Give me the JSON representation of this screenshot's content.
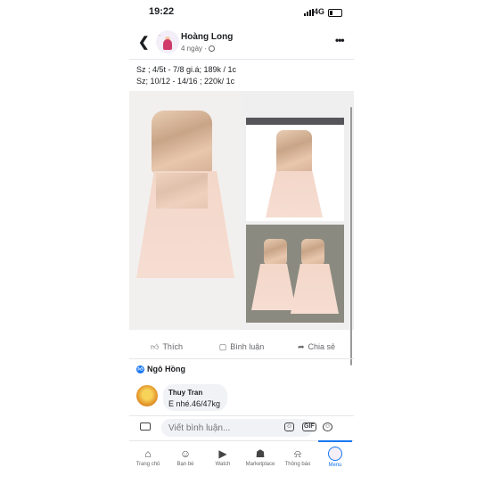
{
  "status": {
    "time": "19:22",
    "network": "4G"
  },
  "header": {
    "author": "Hoàng Long",
    "time_ago": "4 ngày ·"
  },
  "post": {
    "line1": "Sz ; 4/5t - 7/8 gi.á; 189k / 1c",
    "line2": "Sz; 10/12 - 14/16 ;  220k/ 1c"
  },
  "actions": {
    "like": "Thích",
    "comment": "Bình luận",
    "share": "Chia sẻ"
  },
  "reactions": {
    "name": "Ngô Hồng"
  },
  "comment": {
    "author": "Thuy Tran",
    "text": "E nhé.46/47kg"
  },
  "composer": {
    "placeholder": "Viết bình luận..."
  },
  "tabs": {
    "home": "Trang chủ",
    "friends": "Bạn bè",
    "watch": "Watch",
    "marketplace": "Marketplace",
    "notifications": "Thông báo",
    "menu": "Menu"
  },
  "colors": {
    "accent": "#1877f2",
    "dress": "#f3d7c9",
    "sequin": "#c9a487"
  }
}
